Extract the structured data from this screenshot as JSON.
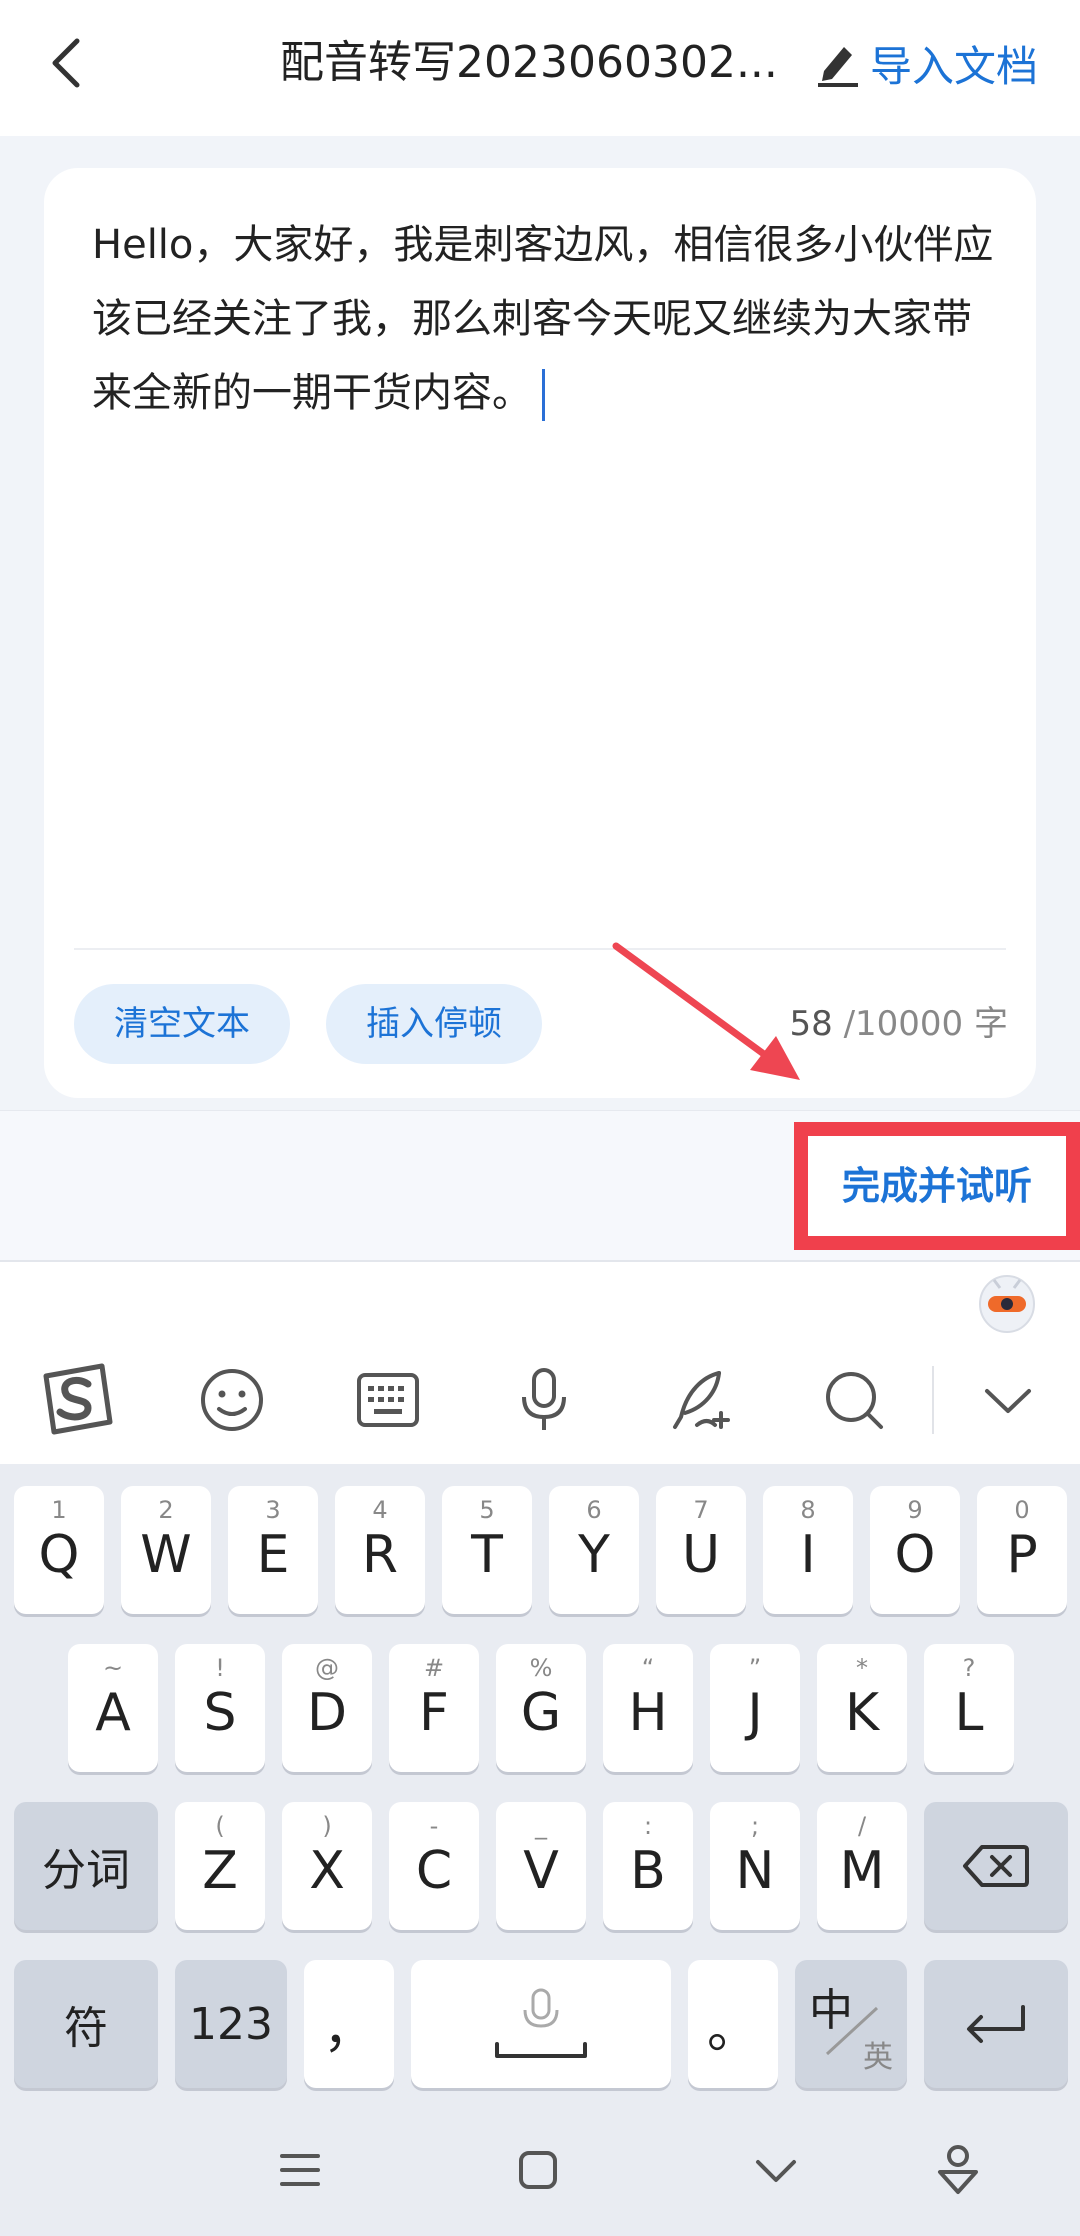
{
  "header": {
    "title": "配音转写2023060302...",
    "import_label": "导入文档"
  },
  "editor": {
    "text": "Hello，大家好，我是刺客边风，相信很多小伙伴应该已经关注了我，那么刺客今天呢又继续为大家带来全新的一期干货内容。",
    "clear_label": "清空文本",
    "insert_pause_label": "插入停顿",
    "char_count": "58",
    "char_limit": "/10000 字"
  },
  "actions": {
    "finish_label": "完成并试听"
  },
  "ime_toolbar": {
    "icons": [
      "sogou-logo-icon",
      "emoji-icon",
      "keyboard-icon",
      "microphone-icon",
      "handwriting-icon",
      "search-icon",
      "chevron-down-icon"
    ]
  },
  "keyboard": {
    "row1": [
      {
        "main": "Q",
        "sub": "1"
      },
      {
        "main": "W",
        "sub": "2"
      },
      {
        "main": "E",
        "sub": "3"
      },
      {
        "main": "R",
        "sub": "4"
      },
      {
        "main": "T",
        "sub": "5"
      },
      {
        "main": "Y",
        "sub": "6"
      },
      {
        "main": "U",
        "sub": "7"
      },
      {
        "main": "I",
        "sub": "8"
      },
      {
        "main": "O",
        "sub": "9"
      },
      {
        "main": "P",
        "sub": "0"
      }
    ],
    "row2": [
      {
        "main": "A",
        "sub": "~"
      },
      {
        "main": "S",
        "sub": "!"
      },
      {
        "main": "D",
        "sub": "@"
      },
      {
        "main": "F",
        "sub": "#"
      },
      {
        "main": "G",
        "sub": "%"
      },
      {
        "main": "H",
        "sub": "“"
      },
      {
        "main": "J",
        "sub": "”"
      },
      {
        "main": "K",
        "sub": "*"
      },
      {
        "main": "L",
        "sub": "?"
      }
    ],
    "row3": [
      {
        "main": "Z",
        "sub": "("
      },
      {
        "main": "X",
        "sub": ")"
      },
      {
        "main": "C",
        "sub": "-"
      },
      {
        "main": "V",
        "sub": "_"
      },
      {
        "main": "B",
        "sub": ":"
      },
      {
        "main": "N",
        "sub": ";"
      },
      {
        "main": "M",
        "sub": "/"
      }
    ],
    "segment_label": "分词",
    "symbol_label": "符",
    "num_label": "123",
    "comma_label": "，",
    "period_label": "。",
    "lang_main": "中",
    "lang_sub": "英"
  },
  "colors": {
    "accent": "#1c73d6",
    "highlight": "#f0404c",
    "arrow": "#ee4652"
  }
}
